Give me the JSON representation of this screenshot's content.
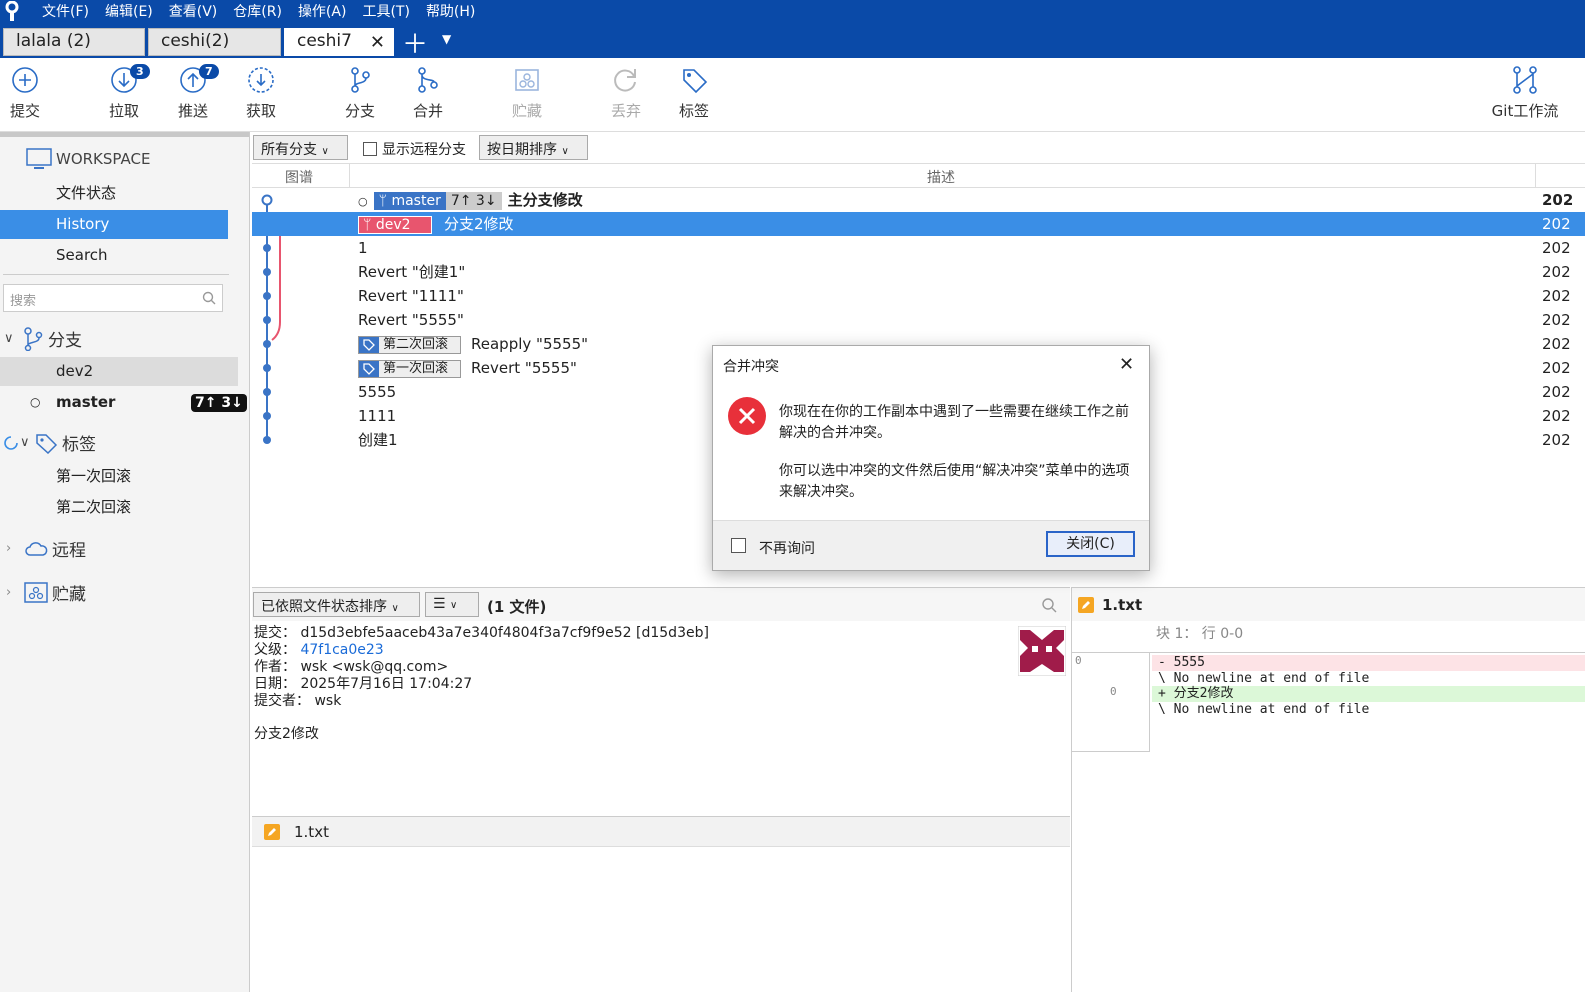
{
  "menubar": {
    "items": [
      "文件(F)",
      "编辑(E)",
      "查看(V)",
      "仓库(R)",
      "操作(A)",
      "工具(T)",
      "帮助(H)"
    ]
  },
  "tabs": [
    "lalala (2)",
    "ceshi(2)",
    "ceshi7"
  ],
  "toolbar": {
    "commit": "提交",
    "pull": "拉取",
    "pull_badge": "3",
    "push": "推送",
    "push_badge": "7",
    "fetch": "获取",
    "branch": "分支",
    "merge": "合并",
    "stash": "贮藏",
    "discard": "丢弃",
    "tag": "标签",
    "gitflow": "Git工作流"
  },
  "sidebar": {
    "workspace": "WORKSPACE",
    "file_status": "文件状态",
    "history": "History",
    "search": "Search",
    "search_placeholder": "搜索",
    "branches_label": "分支",
    "branch_dev2": "dev2",
    "branch_master": "master",
    "master_badge": "7↑ 3↓",
    "tags_label": "标签",
    "tag1": "第一次回滚",
    "tag2": "第二次回滚",
    "remote_label": "远程",
    "stash_label": "贮藏"
  },
  "filter": {
    "all_branches": "所有分支",
    "show_remote": "显示远程分支",
    "sort": "按日期排序"
  },
  "columns": {
    "graph": "图谱",
    "desc": "描述"
  },
  "commits": [
    {
      "ref": "master",
      "ahead": "7↑ 3↓",
      "desc": "主分支修改",
      "date": "202"
    },
    {
      "ref": "dev2",
      "desc": "分支2修改",
      "date": "202"
    },
    {
      "desc": "1",
      "date": "202"
    },
    {
      "desc": "Revert \"创建1\"",
      "date": "202"
    },
    {
      "desc": "Revert \"1111\"",
      "date": "202"
    },
    {
      "desc": "Revert \"5555\"",
      "date": "202"
    },
    {
      "tag": "第二次回滚",
      "desc": "Reapply \"5555\"",
      "date": "202"
    },
    {
      "tag": "第一次回滚",
      "desc": "Revert \"5555\"",
      "date": "202"
    },
    {
      "desc": "5555",
      "date": "202"
    },
    {
      "desc": "1111",
      "date": "202"
    },
    {
      "desc": "创建1",
      "date": "202"
    }
  ],
  "details": {
    "sort_label": "已依照文件状态排序",
    "file_count": "(1 文件)",
    "commit_label": "提交：",
    "commit_value": "d15d3ebfe5aaceb43a7e340f4804f3a7cf9f9e52 [d15d3eb]",
    "parent_label": "父级：",
    "parent_value": "47f1ca0e23",
    "author_label": "作者：",
    "author_value": "wsk <wsk@qq.com>",
    "date_label": "日期：",
    "date_value": "2025年7月16日 17:04:27",
    "committer_label": "提交者：",
    "committer_value": "wsk",
    "message": "分支2修改",
    "file": "1.txt"
  },
  "diff": {
    "file": "1.txt",
    "hunk": "块 1： 行 0-0",
    "old_line": "0",
    "new_line": "0",
    "lines": [
      "- 5555",
      "\\  No newline at end of file",
      "+ 分支2修改",
      "\\  No newline at end of file"
    ]
  },
  "dialog": {
    "title": "合并冲突",
    "msg1": "你现在在你的工作副本中遇到了一些需要在继续工作之前解决的合并冲突。",
    "msg2": "你可以选中冲突的文件然后使用“解决冲突”菜单中的选项来解决冲突。",
    "dont_ask": "不再询问",
    "close": "关闭(C)"
  },
  "colors": {
    "accent": "#0a4aa8",
    "selection": "#3a8ee6",
    "branch_blue": "#3a74c6",
    "branch_red": "#e8556e"
  }
}
